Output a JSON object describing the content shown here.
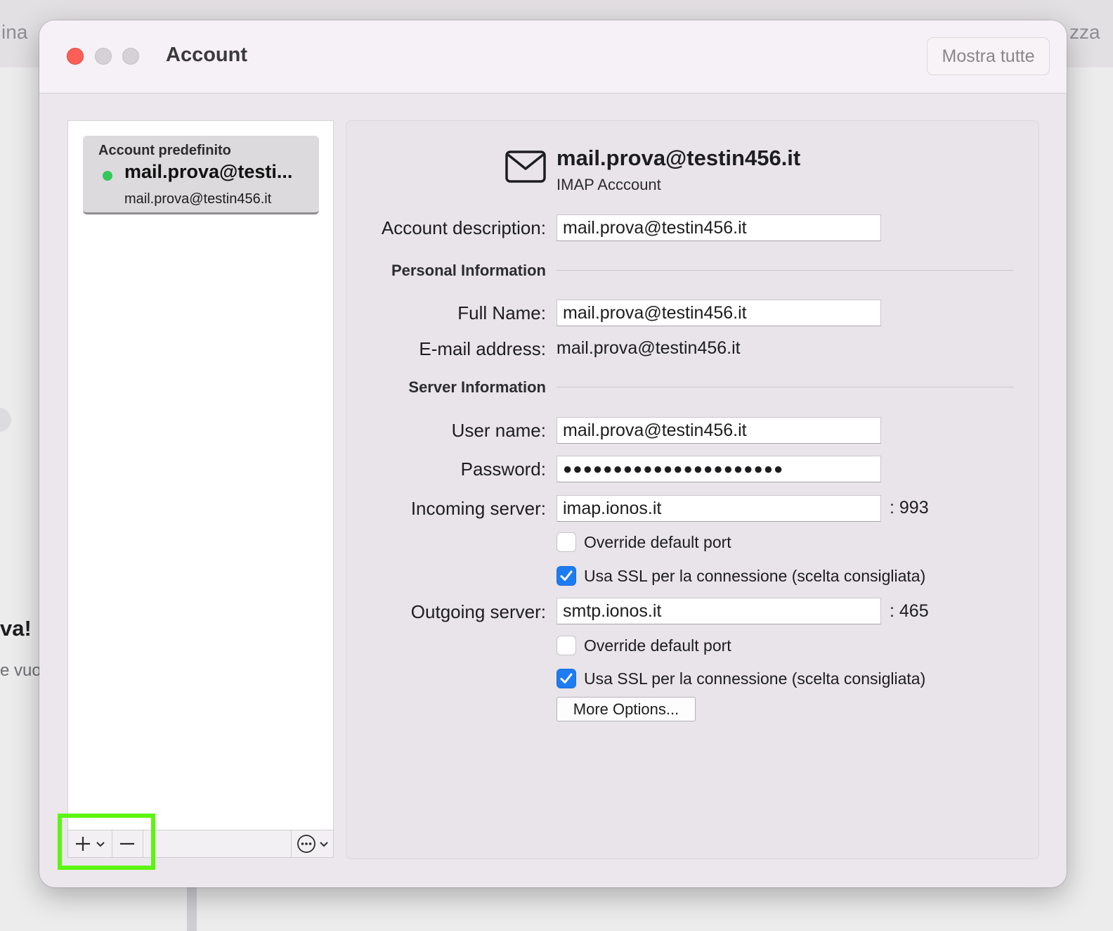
{
  "background": {
    "left_edge_text": "ina",
    "right_edge_text": "zza",
    "left_heading_fragment": "va!",
    "left_sub_fragment": "e vuot"
  },
  "window": {
    "title": "Account",
    "show_all_label": "Mostra tutte"
  },
  "sidebar": {
    "accounts": [
      {
        "group_label": "Account predefinito",
        "name": "mail.prova@testi...",
        "email": "mail.prova@testin456.it",
        "status_color": "#34c759"
      }
    ],
    "toolbar": {
      "add_icon": "plus-icon",
      "add_menu_icon": "chevron-down-icon",
      "remove_icon": "minus-icon",
      "more_icon": "ellipsis-circle-icon"
    }
  },
  "detail": {
    "header": {
      "icon": "envelope-icon",
      "title": "mail.prova@testin456.it",
      "subtitle": "IMAP Acccount"
    },
    "account_description": {
      "label": "Account description:",
      "value": "mail.prova@testin456.it"
    },
    "personal_section": "Personal Information",
    "full_name": {
      "label": "Full Name:",
      "value": "mail.prova@testin456.it"
    },
    "email_address": {
      "label": "E-mail address:",
      "value": "mail.prova@testin456.it"
    },
    "server_section": "Server Information",
    "user_name": {
      "label": "User name:",
      "value": "mail.prova@testin456.it"
    },
    "password": {
      "label": "Password:",
      "value": "●●●●●●●●●●●●●●●●●●●●●●"
    },
    "incoming": {
      "label": "Incoming server:",
      "value": "imap.ionos.it",
      "port": ": 993",
      "override_label": "Override default port",
      "override_checked": false,
      "ssl_label": "Usa SSL per la connessione (scelta consigliata)",
      "ssl_checked": true
    },
    "outgoing": {
      "label": "Outgoing server:",
      "value": "smtp.ionos.it",
      "port": ": 465",
      "override_label": "Override default port",
      "override_checked": false,
      "ssl_label": "Usa SSL per la connessione (scelta consigliata)",
      "ssl_checked": true
    },
    "more_options_label": "More Options..."
  },
  "colors": {
    "accent": "#1e7cf2",
    "close_button": "#ff5f57",
    "highlight": "#5cf50f"
  }
}
